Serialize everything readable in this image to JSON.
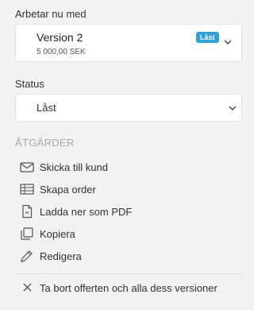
{
  "working_on": {
    "label": "Arbetar nu med",
    "version_title": "Version 2",
    "amount": "5 000,00 SEK",
    "badge": "Låst"
  },
  "status": {
    "label": "Status",
    "value": "Låst"
  },
  "actions": {
    "heading": "ÅTGÄRDER",
    "items": [
      {
        "label": "Skicka till kund",
        "icon": "envelope-icon"
      },
      {
        "label": "Skapa order",
        "icon": "table-icon"
      },
      {
        "label": "Ladda ner som PDF",
        "icon": "pdf-file-icon"
      },
      {
        "label": "Kopiera",
        "icon": "copy-icon"
      },
      {
        "label": "Redigera",
        "icon": "pencil-icon"
      }
    ],
    "delete_label": "Ta bort offerten och alla dess versioner"
  },
  "colors": {
    "badge": "#2d9fda",
    "heading_muted": "#a9a9a9"
  }
}
